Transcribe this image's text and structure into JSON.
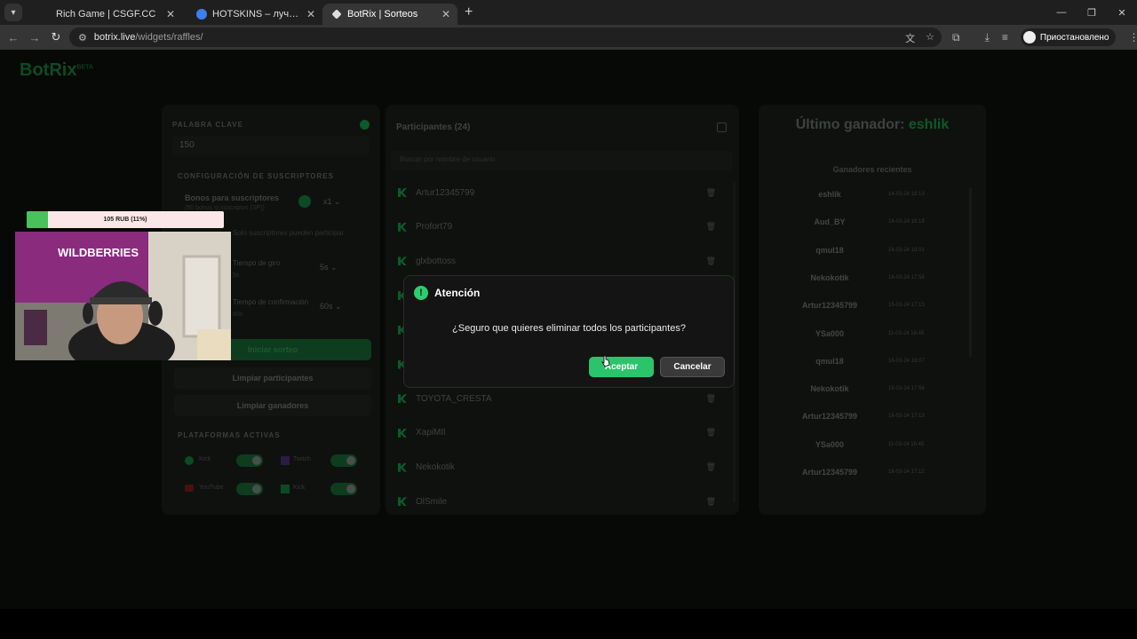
{
  "browser": {
    "tabs": [
      {
        "title": "Rich Game | CSGF.CC",
        "active": false
      },
      {
        "title": "HOTSKINS – лучшие выигрыши",
        "active": false
      },
      {
        "title": "BotRix | Sorteos",
        "active": true
      }
    ],
    "url_host": "botrix.live",
    "url_path": "/widgets/raffles/",
    "profile_label": "Приостановлено"
  },
  "logo": {
    "name": "BotRix",
    "badge": "BETA"
  },
  "left_panel": {
    "keyword_label": "PALABRA CLAVE",
    "keyword_value": "150",
    "subs_config_label": "CONFIGURACIÓN DE SUSCRIPTORES",
    "bonus_label": "Bonos para suscriptores",
    "bonus_sub": "(50 bonus si suscriptos (SP))",
    "bonus_value": "x1",
    "only_subs": "Solo suscriptores pueden participar",
    "spin_label": "Tiempo de giro",
    "spin_value": "5s",
    "spin_hint": "5s",
    "confirm_label": "Tiempo de confirmación",
    "confirm_hint": "60s",
    "confirm_value": "60s",
    "start_button": "Iniciar sorteo",
    "clear_participants": "Limpiar participantes",
    "clear_winners": "Limpiar ganadores",
    "platforms_label": "PLATAFORMAS ACTIVAS",
    "platforms": [
      {
        "name": "Kick",
        "enabled": true
      },
      {
        "name": "Twitch",
        "enabled": true
      },
      {
        "name": "YouTube",
        "enabled": true
      },
      {
        "name": "Kick",
        "enabled": true
      }
    ]
  },
  "participants": {
    "title": "Participantes (24)",
    "search_placeholder": "Buscar por nombre de usuario",
    "items": [
      "Artur12345799",
      "Profort79",
      "glxbottoss",
      "",
      "",
      "",
      "TOYOTA_CRESTA",
      "XapiMIl",
      "Nekokotik",
      "OlSmile"
    ]
  },
  "winners": {
    "title_prefix": "Último ganador:",
    "last_winner": "eshlik",
    "recent_label": "Ganadores recientes",
    "items": [
      {
        "name": "eshlik",
        "date": "14-03-24 18:13"
      },
      {
        "name": "Aud_BY",
        "date": "16-03-24 18:19"
      },
      {
        "name": "qmul18",
        "date": "16-03-24 18:01"
      },
      {
        "name": "Nekokotik",
        "date": "16-03-24 17:58"
      },
      {
        "name": "Artur12345799",
        "date": "15-03-24 17:13"
      },
      {
        "name": "YSa000",
        "date": "11-03-24 16:45"
      },
      {
        "name": "qmul18",
        "date": "16-03-24 18:07"
      },
      {
        "name": "Nekokotik",
        "date": "16-03-24 17:56"
      },
      {
        "name": "Artur12345799",
        "date": "16-03-24 17:13"
      },
      {
        "name": "YSa000",
        "date": "11-03-24 16:45"
      },
      {
        "name": "Artur12345799",
        "date": "16-03-24 17:12"
      }
    ]
  },
  "overlay": {
    "progress_text": "105 RUB (11%)",
    "progress_fraction": 0.11,
    "sign_text": "WILDBERRIES"
  },
  "modal": {
    "title": "Atención",
    "message": "¿Seguro que quieres eliminar todos los participantes?",
    "accept": "Aceptar",
    "cancel": "Cancelar"
  }
}
